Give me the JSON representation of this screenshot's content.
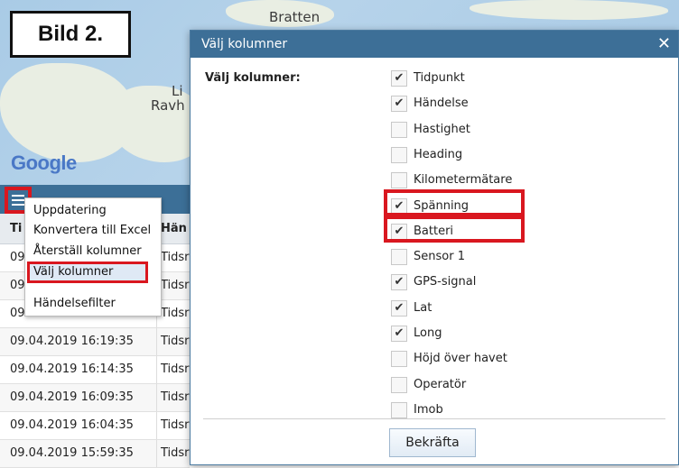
{
  "annotation_label": "Bild 2.",
  "map": {
    "place_top": "Bratten",
    "place_left_1": "Li",
    "place_left_2": "Ravh",
    "brand": "Google"
  },
  "grid": {
    "header_col1": "Ti",
    "header_col2": "Hän",
    "rows": [
      {
        "time": "09",
        "event": "Tidsr"
      },
      {
        "time": "09",
        "event": "Tidsr"
      },
      {
        "time": "09",
        "event": "Tidsr"
      },
      {
        "time": "09.04.2019 16:19:35",
        "event": "Tidsr"
      },
      {
        "time": "09.04.2019 16:14:35",
        "event": "Tidsr"
      },
      {
        "time": "09.04.2019 16:09:35",
        "event": "Tidsr"
      },
      {
        "time": "09.04.2019 16:04:35",
        "event": "Tidsr"
      },
      {
        "time": "09.04.2019 15:59:35",
        "event": "Tidsr"
      }
    ]
  },
  "context_menu": {
    "items": [
      "Uppdatering",
      "Konvertera till Excel",
      "Återställ kolumner",
      "Välj kolumner",
      "Händelsefilter"
    ],
    "selected": "Välj kolumner"
  },
  "dialog": {
    "title": "Välj kolumner",
    "close_symbol": "✕",
    "section_label": "Välj kolumner:",
    "options": [
      {
        "label": "Tidpunkt",
        "checked": true
      },
      {
        "label": "Händelse",
        "checked": true
      },
      {
        "label": "Hastighet",
        "checked": false
      },
      {
        "label": "Heading",
        "checked": false
      },
      {
        "label": "Kilometermätare",
        "checked": false
      },
      {
        "label": "Spänning",
        "checked": true
      },
      {
        "label": "Batteri",
        "checked": true
      },
      {
        "label": "Sensor 1",
        "checked": false
      },
      {
        "label": "GPS-signal",
        "checked": true
      },
      {
        "label": "Lat",
        "checked": true
      },
      {
        "label": "Long",
        "checked": true
      },
      {
        "label": "Höjd över havet",
        "checked": false
      },
      {
        "label": "Operatör",
        "checked": false
      },
      {
        "label": "Imob",
        "checked": false
      }
    ],
    "confirm_label": "Bekräfta"
  },
  "colors": {
    "header_blue": "#3d6f97",
    "highlight_red": "#d9171f"
  }
}
